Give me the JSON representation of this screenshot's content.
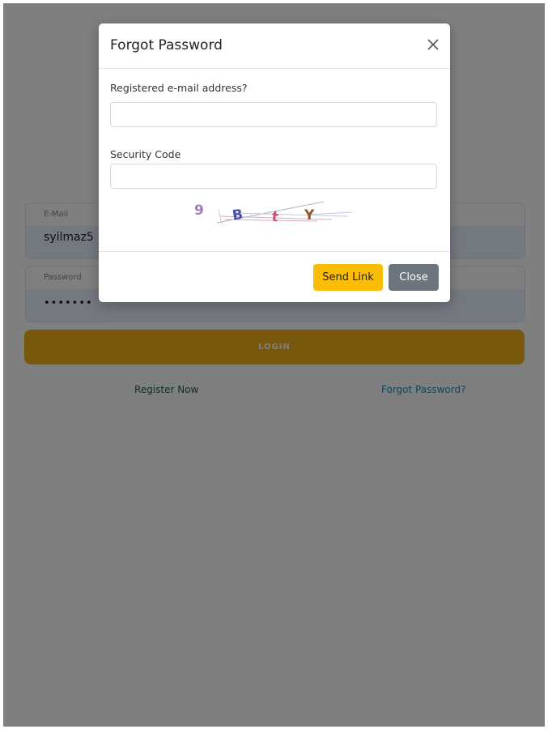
{
  "login": {
    "email_label": "E-Mail",
    "email_value": "syilmaz5",
    "password_label": "Password",
    "password_value": "•••••••",
    "login_button": "LOGIN",
    "register_link": "Register Now",
    "forgot_link": "Forgot Password?"
  },
  "modal": {
    "title": "Forgot Password",
    "email_label": "Registered e-mail address?",
    "email_value": "",
    "code_label": "Security Code",
    "code_value": "",
    "captcha_chars": [
      "9",
      "B",
      "t",
      "Y"
    ],
    "send_button": "Send Link",
    "close_button": "Close"
  },
  "colors": {
    "accent": "#fbbd08",
    "login_button": "#f0b316",
    "close_button": "#6c757d",
    "register_link": "#1f5c3a",
    "forgot_link": "#1b8eb5"
  }
}
